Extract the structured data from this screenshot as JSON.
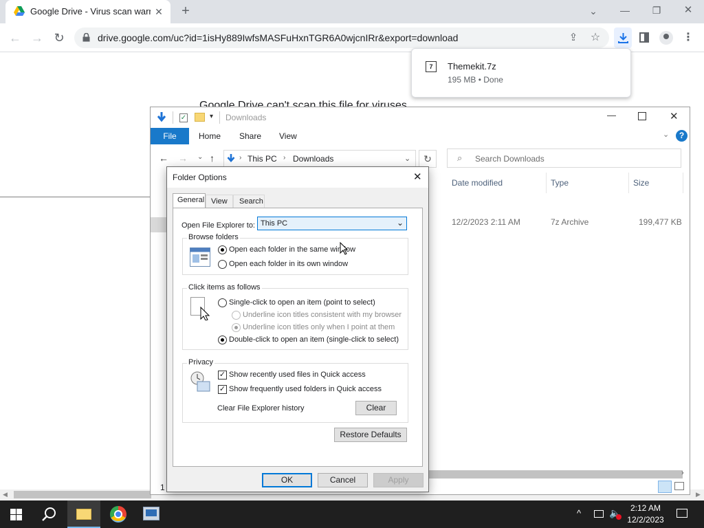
{
  "chrome": {
    "tab_title": "Google Drive - Virus scan warning",
    "url": "drive.google.com/uc?id=1isHy889IwfsMASFuHxnTGR6A0wjcnIRr&export=download",
    "page_heading": "Google Drive can't scan this file for viruses.",
    "download": {
      "filename": "Themekit.7z",
      "status": "195 MB • Done"
    }
  },
  "explorer": {
    "title": "Downloads",
    "ribbon_tabs": [
      "File",
      "Home",
      "Share",
      "View"
    ],
    "breadcrumb": [
      "This PC",
      "Downloads"
    ],
    "search_placeholder": "Search Downloads",
    "columns": {
      "date": "Date modified",
      "type": "Type",
      "size": "Size"
    },
    "row": {
      "date": "12/2/2023 2:11 AM",
      "type": "7z Archive",
      "size": "199,477 KB"
    },
    "status_count": "1"
  },
  "dialog": {
    "title": "Folder Options",
    "tabs": [
      "General",
      "View",
      "Search"
    ],
    "open_to_label": "Open File Explorer to:",
    "open_to_value": "This PC",
    "browse": {
      "title": "Browse folders",
      "same_window": "Open each folder in the same window",
      "own_window": "Open each folder in its own window"
    },
    "click": {
      "title": "Click items as follows",
      "single": "Single-click to open an item (point to select)",
      "underline_browser": "Underline icon titles consistent with my browser",
      "underline_point": "Underline icon titles only when I point at them",
      "double": "Double-click to open an item (single-click to select)"
    },
    "privacy": {
      "title": "Privacy",
      "recent_files": "Show recently used files in Quick access",
      "frequent_folders": "Show frequently used folders in Quick access",
      "clear_history": "Clear File Explorer history",
      "clear_button": "Clear"
    },
    "restore_defaults": "Restore Defaults",
    "ok": "OK",
    "cancel": "Cancel",
    "apply": "Apply"
  },
  "taskbar": {
    "time": "2:12 AM",
    "date": "12/2/2023"
  }
}
